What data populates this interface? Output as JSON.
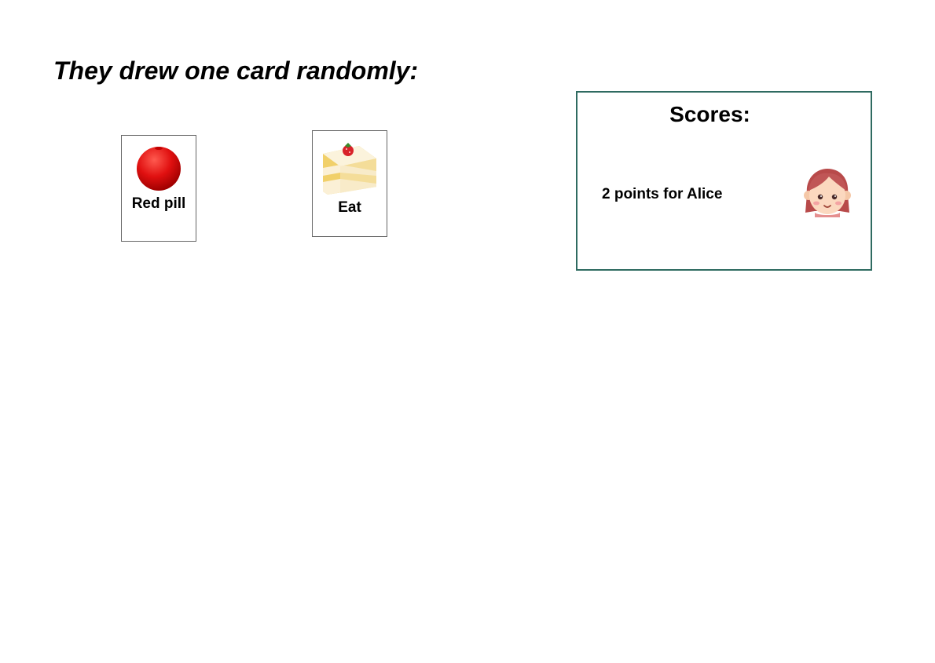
{
  "heading": "They drew one card randomly:",
  "cards": [
    {
      "label": "Red pill",
      "icon": "red-circle-icon",
      "color": "#e01010"
    },
    {
      "label": "Eat",
      "icon": "shortcake-icon"
    }
  ],
  "scores": {
    "title": "Scores:",
    "line": "2 points for Alice",
    "avatar_icon": "girl-avatar-icon",
    "border_color": "#2f6b61"
  }
}
